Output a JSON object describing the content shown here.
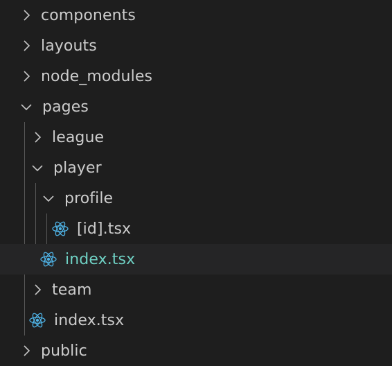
{
  "explorer": {
    "items": [
      {
        "label": "components",
        "type": "folder",
        "expanded": false,
        "depth": 0
      },
      {
        "label": "layouts",
        "type": "folder",
        "expanded": false,
        "depth": 0
      },
      {
        "label": "node_modules",
        "type": "folder",
        "expanded": false,
        "depth": 0
      },
      {
        "label": "pages",
        "type": "folder",
        "expanded": true,
        "depth": 0
      },
      {
        "label": "league",
        "type": "folder",
        "expanded": false,
        "depth": 1
      },
      {
        "label": "player",
        "type": "folder",
        "expanded": true,
        "depth": 1
      },
      {
        "label": "profile",
        "type": "folder",
        "expanded": true,
        "depth": 2
      },
      {
        "label": "[id].tsx",
        "type": "file",
        "icon": "react-icon",
        "depth": 3
      },
      {
        "label": "index.tsx",
        "type": "file",
        "icon": "react-icon",
        "depth": 2,
        "selected": true
      },
      {
        "label": "team",
        "type": "folder",
        "expanded": false,
        "depth": 1
      },
      {
        "label": "index.tsx",
        "type": "file",
        "icon": "react-icon",
        "depth": 1
      },
      {
        "label": "public",
        "type": "folder",
        "expanded": false,
        "depth": 0
      }
    ]
  },
  "colors": {
    "background": "#1e1e1e",
    "selected_row": "#252526",
    "text": "#cccccc",
    "selected_text": "#6fd1c4",
    "react_icon": "#4fb3e6",
    "chevron": "#c5c5c5",
    "indent_guide": "#585858"
  }
}
